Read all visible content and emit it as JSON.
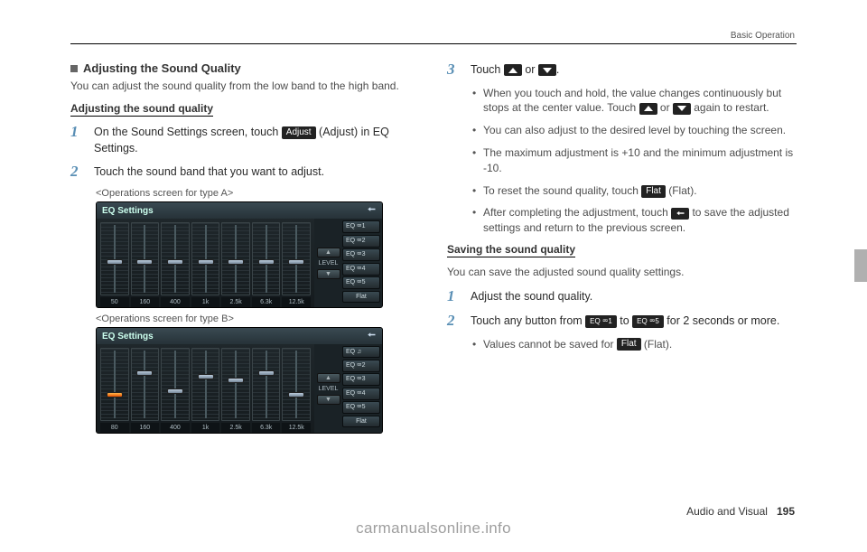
{
  "header": {
    "breadcrumb": "Basic Operation"
  },
  "section": {
    "title": "Adjusting the Sound Quality",
    "intro": "You can adjust the sound quality from the low band to the high band.",
    "subheading": "Adjusting the sound quality"
  },
  "left_steps": {
    "s1_pre": "On the Sound Settings screen, touch ",
    "s1_pill": "Adjust",
    "s1_post": " (Adjust) in EQ Settings.",
    "s2": "Touch the sound band that you want to adjust.",
    "captionA": "<Operations screen for type A>",
    "captionB": "<Operations screen for type B>"
  },
  "eq_panel": {
    "title": "EQ Settings",
    "freqsA": [
      "50",
      "160",
      "400",
      "1k",
      "2.5k",
      "6.3k",
      "12.5k"
    ],
    "thumbPosA": [
      50,
      50,
      50,
      50,
      50,
      50,
      50
    ],
    "freqsB": [
      "80",
      "160",
      "400",
      "1k",
      "2.5k",
      "6.3k",
      "12.5k"
    ],
    "thumbPosB": [
      60,
      30,
      55,
      35,
      40,
      30,
      60
    ],
    "level_label": "LEVEL",
    "presets1": [
      "EQ ⮹1",
      "EQ ⮹2",
      "EQ ⮹3",
      "EQ ⮹4",
      "EQ ⮹5"
    ],
    "presetsB0": "EQ     ♫",
    "flat": "Flat"
  },
  "right": {
    "s3_pre": "Touch ",
    "s3_mid": " or ",
    "s3_post": ".",
    "bullets": [
      {
        "pre": "When you touch and hold, the value changes continuously but stops at the center value. Touch ",
        "mid": " or ",
        "post": " again to restart."
      },
      {
        "text": "You can also adjust to the desired level by touching the screen."
      },
      {
        "text": "The maximum adjustment is +10 and the minimum adjustment is -10."
      },
      {
        "pre": "To reset the sound quality, touch ",
        "pill": "Flat",
        "post": " (Flat)."
      },
      {
        "pre": "After completing the adjustment, touch ",
        "back": true,
        "post": " to save the adjusted settings and return to the previous screen."
      }
    ],
    "save_heading": "Saving the sound quality",
    "save_intro": "You can save the adjusted sound quality settings.",
    "save_s1": "Adjust the sound quality.",
    "save_s2_pre": "Touch any button from ",
    "save_s2_mid": " to ",
    "save_s2_post": " for 2 seconds or more.",
    "save_bullet_pre": "Values cannot be saved for ",
    "save_bullet_pill": "Flat",
    "save_bullet_post": " (Flat).",
    "chip1": "EQ ⮹1",
    "chip5": "EQ ⮹5"
  },
  "footer": {
    "section": "Audio and Visual",
    "page": "195"
  },
  "watermark": "carmanualsonline.info"
}
